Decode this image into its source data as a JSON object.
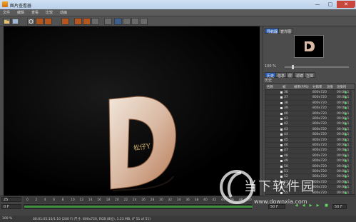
{
  "window": {
    "title": "图片查看器",
    "controls": [
      "—",
      "□",
      "✕"
    ]
  },
  "menu": [
    "文件",
    "编辑",
    "查看",
    "比较",
    "动画"
  ],
  "toolbar": {
    "icons": [
      "folder-icon",
      "save-icon",
      "settings-icon",
      "stop-icon",
      "render-icon",
      "render-region-icon",
      "compare-icon",
      "split-icon",
      "ab-icon",
      "channel-icon",
      "fit-icon",
      "grid-icon",
      "zoom-icon",
      "zoom-out-icon"
    ]
  },
  "canvas": {
    "overlay_text": "松仔Y"
  },
  "panel": {
    "tabs": [
      "导航器",
      "直方图"
    ],
    "zoom_label": "100 %",
    "lower_tabs": [
      "历史",
      "信息",
      "层",
      "滤镜",
      "立体"
    ],
    "history_label": "历史",
    "columns": [
      "名称",
      "帧",
      "帧率(FPS)",
      "分辨率",
      "渲染",
      "渲染时"
    ],
    "rows": [
      {
        "frame": "36",
        "res": "800x720",
        "time": "00:00:1"
      },
      {
        "frame": "37",
        "res": "800x720",
        "time": "00:00:1"
      },
      {
        "frame": "38",
        "res": "800x720",
        "time": "00:00:1"
      },
      {
        "frame": "39",
        "res": "800x720",
        "time": "00:00:1"
      },
      {
        "frame": "40",
        "res": "800x720",
        "time": "00:00:1"
      },
      {
        "frame": "41",
        "res": "800x720",
        "time": "00:00:1"
      },
      {
        "frame": "42",
        "res": "800x720",
        "time": "00:00:1"
      },
      {
        "frame": "43",
        "res": "800x720",
        "time": "00:00:1"
      },
      {
        "frame": "44",
        "res": "800x720",
        "time": "00:00:1"
      },
      {
        "frame": "45",
        "res": "800x720",
        "time": "00:00:1"
      },
      {
        "frame": "46",
        "res": "800x720",
        "time": "00:00:1"
      },
      {
        "frame": "47",
        "res": "800x720",
        "time": "00:00:1"
      },
      {
        "frame": "48",
        "res": "800x720",
        "time": "00:00:1"
      },
      {
        "frame": "49",
        "res": "800x720",
        "time": "00:00:1"
      },
      {
        "frame": "50",
        "res": "800x720",
        "time": "00:00:1"
      },
      {
        "frame": "51",
        "res": "800x720",
        "time": "00:00:1"
      },
      {
        "frame": "52",
        "res": "800x720",
        "time": "00:00:1"
      },
      {
        "frame": "53",
        "res": "800x720",
        "time": "00:00:1"
      },
      {
        "frame": "54",
        "res": "800x720",
        "time": "00:00:1"
      },
      {
        "frame": "55",
        "res": "800x720",
        "time": "00:00:1"
      }
    ]
  },
  "timeline": {
    "current_frame_top": "25",
    "current_frame_bottom": "0 F",
    "ticks": [
      "0",
      "2",
      "4",
      "6",
      "8",
      "10",
      "12",
      "14",
      "16",
      "18",
      "20",
      "22",
      "24",
      "26",
      "28",
      "30",
      "32",
      "34",
      "36",
      "38",
      "40",
      "42",
      "44",
      "46",
      "48",
      "50"
    ],
    "end_field": "50 F",
    "fps_field": "50 F"
  },
  "status": {
    "zoom": "100 %",
    "info": "00:01:05:10/1:10 (200 F)   尺寸: 800x720, RGB (8位), 1.23 MB, (F 51 of 51)"
  },
  "watermark": {
    "brand": "当下软件园",
    "url": "www.downxia.com"
  }
}
